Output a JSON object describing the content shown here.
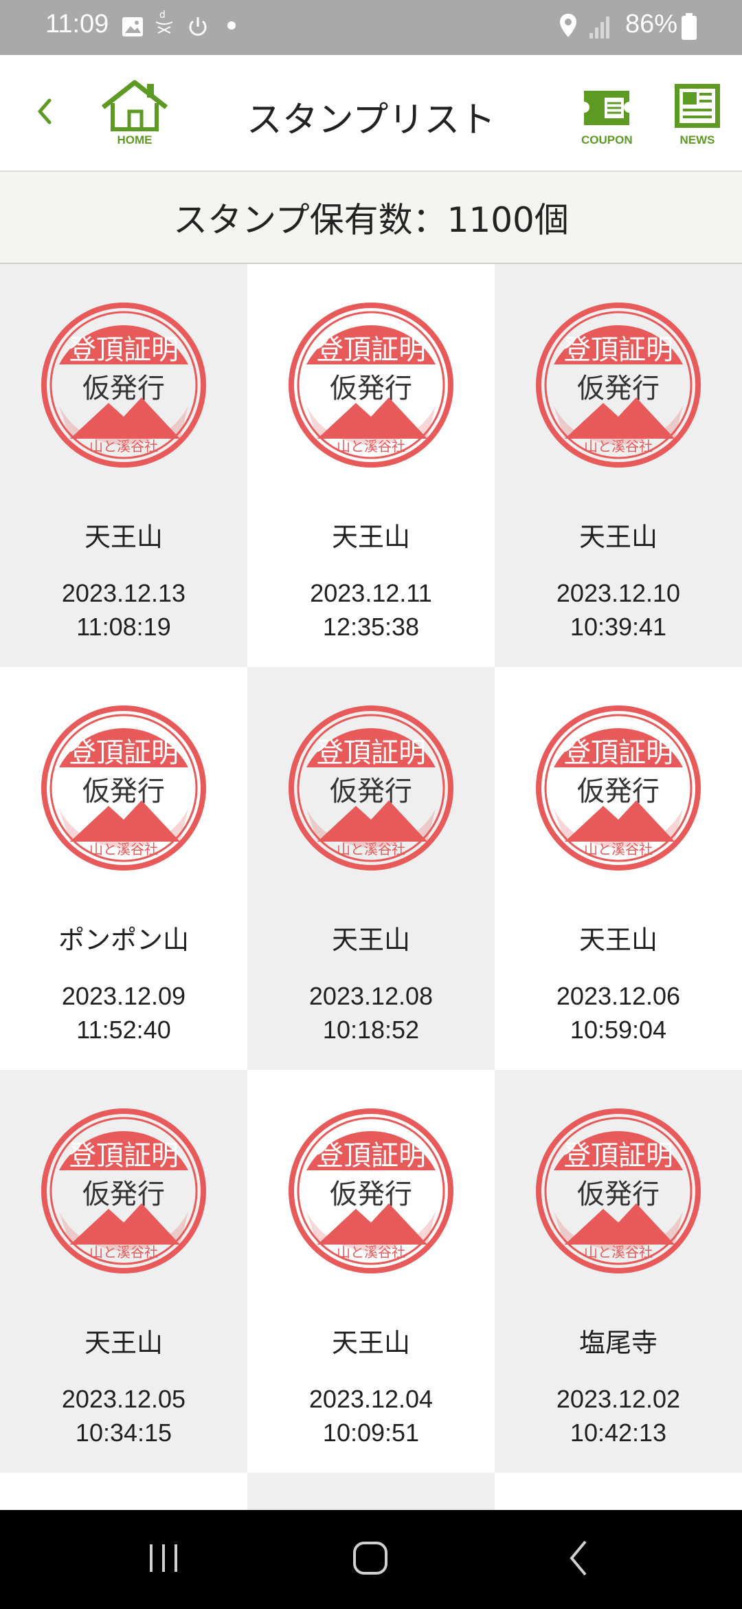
{
  "status_bar": {
    "time": "11:09",
    "battery": "86%",
    "icons": [
      "gallery-icon",
      "docomo-icon",
      "power-icon",
      "dot-icon",
      "location-icon",
      "signal-icon",
      "battery-icon"
    ]
  },
  "header": {
    "title": "スタンプリスト",
    "home_caption": "HOME",
    "coupon_caption": "COUPON",
    "news_caption": "NEWS",
    "accent_color": "#5c9a24"
  },
  "summary": {
    "count_text": "スタンプ保有数：1100個"
  },
  "stamp_image": {
    "line1": "登頂証明",
    "line2": "仮発行",
    "brand": "山と溪谷社",
    "color": "#e85a5a"
  },
  "stamps": [
    {
      "name": "天王山",
      "date": "2023.12.13",
      "time": "11:08:19"
    },
    {
      "name": "天王山",
      "date": "2023.12.11",
      "time": "12:35:38"
    },
    {
      "name": "天王山",
      "date": "2023.12.10",
      "time": "10:39:41"
    },
    {
      "name": "ポンポン山",
      "date": "2023.12.09",
      "time": "11:52:40"
    },
    {
      "name": "天王山",
      "date": "2023.12.08",
      "time": "10:18:52"
    },
    {
      "name": "天王山",
      "date": "2023.12.06",
      "time": "10:59:04"
    },
    {
      "name": "天王山",
      "date": "2023.12.05",
      "time": "10:34:15"
    },
    {
      "name": "天王山",
      "date": "2023.12.04",
      "time": "10:09:51"
    },
    {
      "name": "塩尾寺",
      "date": "2023.12.02",
      "time": "10:42:13"
    }
  ]
}
